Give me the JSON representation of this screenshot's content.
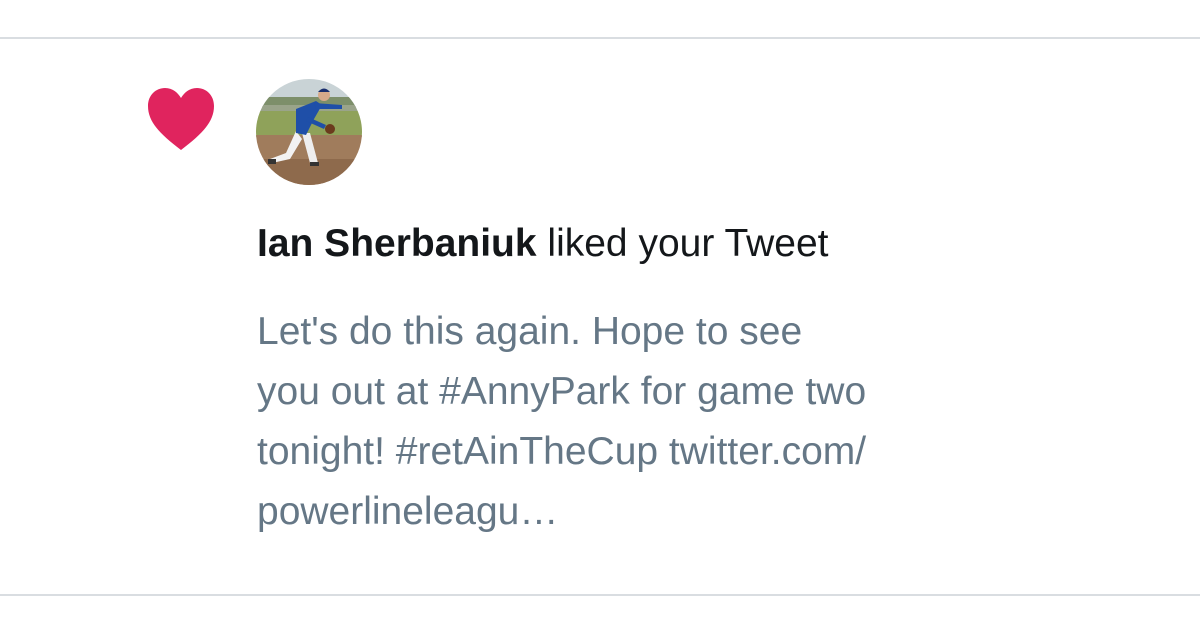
{
  "notification": {
    "type_icon": "heart-icon",
    "avatar_icon": "avatar-photo-baseball-pitcher",
    "user_name": "Ian Sherbaniuk",
    "action_text": " liked your Tweet",
    "tweet_lines": [
      "Let's do this again. Hope to see",
      "you out at #AnnyPark for game two",
      "tonight! #retAinTheCup twitter.com/",
      "powerlineleagu…"
    ]
  },
  "colors": {
    "heart": "#e0245e",
    "name_text": "#14171a",
    "tweet_text": "#657786",
    "divider": "#d9dde1",
    "background": "#ffffff"
  }
}
